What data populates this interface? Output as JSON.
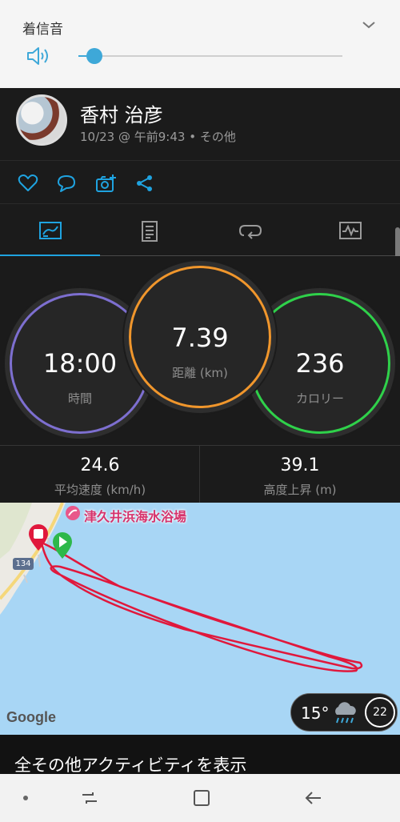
{
  "volume_panel": {
    "title": "着信音",
    "level": 0.03,
    "accent_color": "#3ea8d8"
  },
  "activity": {
    "user_name": "香村 治彦",
    "meta": "10/23 @ 午前9:43 • その他"
  },
  "actions": [
    "heart-icon",
    "comment-icon",
    "camera-add-icon",
    "share-icon"
  ],
  "tabs": [
    {
      "name": "overview",
      "icon": "overview-icon",
      "active": true
    },
    {
      "name": "details",
      "icon": "document-icon",
      "active": false
    },
    {
      "name": "laps",
      "icon": "laps-icon",
      "active": false
    },
    {
      "name": "charts",
      "icon": "chart-icon",
      "active": false
    }
  ],
  "stats": {
    "time": {
      "value": "18:00",
      "label": "時間",
      "color": "#7d6fd0"
    },
    "distance": {
      "value": "7.39",
      "label": "距離 (km)",
      "color": "#f0962c"
    },
    "calories": {
      "value": "236",
      "label": "カロリー",
      "color": "#2fd14a"
    }
  },
  "secondary_stats": [
    {
      "value": "24.6",
      "label": "平均速度 (km/h)"
    },
    {
      "value": "39.1",
      "label": "高度上昇 (m)"
    }
  ],
  "map": {
    "poi": "津久井浜海水浴場",
    "road_number": "134",
    "google_label": "Google",
    "weather": {
      "temperature": "15°",
      "icon": "rain-cloud-icon",
      "wind_speed": "22"
    },
    "track_color": "#e0183c"
  },
  "more_link": "全その他アクティビティを表示"
}
